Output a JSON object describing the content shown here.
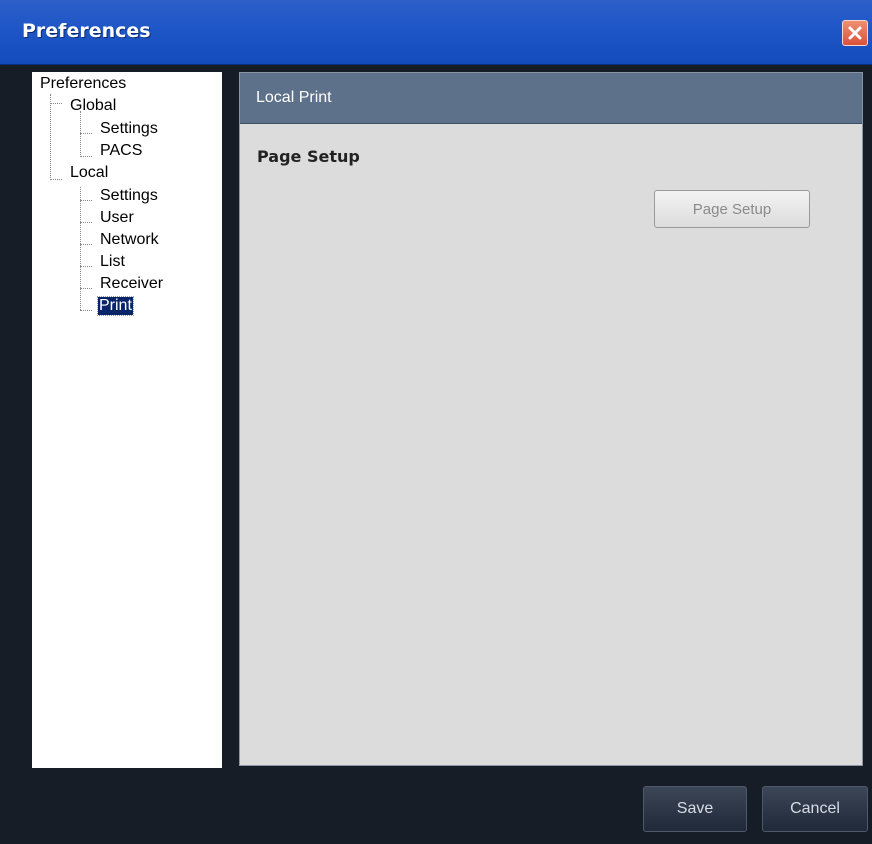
{
  "window": {
    "title": "Preferences"
  },
  "tree": {
    "root": "Preferences",
    "global_label": "Global",
    "global_items": [
      "Settings",
      "PACS"
    ],
    "local_label": "Local",
    "local_items": [
      "Settings",
      "User",
      "Network",
      "List",
      "Receiver",
      "Print"
    ],
    "selected": "Print"
  },
  "panel": {
    "header": "Local Print",
    "section_title": "Page Setup",
    "page_setup_button": "Page Setup"
  },
  "footer": {
    "save_label": "Save",
    "cancel_label": "Cancel"
  },
  "icons": {
    "close": "close-icon"
  },
  "colors": {
    "titlebar": "#1f56c7",
    "panel_header": "#5d718a",
    "selection": "#0a246a",
    "window_background": "#161d27",
    "close_button": "#d9533a"
  }
}
